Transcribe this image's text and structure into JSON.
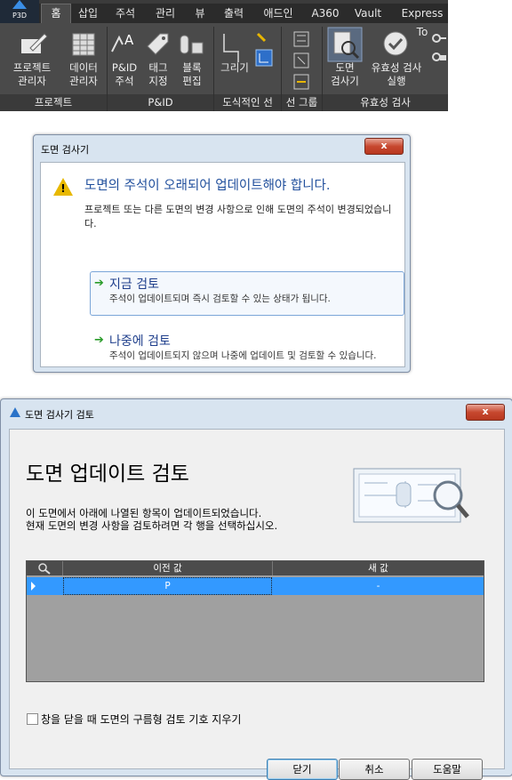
{
  "ribbon": {
    "app_button": "P3D",
    "tabs": [
      "홈",
      "삽입",
      "주석",
      "관리",
      "뷰",
      "출력",
      "애드인",
      "A360",
      "Vault",
      "Express To"
    ],
    "buttons": {
      "project_manager": [
        "프로젝트",
        "관리자"
      ],
      "data_manager": [
        "데이터",
        "관리자"
      ],
      "pid_annotation": [
        "P&ID",
        "주석"
      ],
      "tag_assign": [
        "태그",
        "지정"
      ],
      "block_edit": [
        "블록",
        "편집"
      ],
      "draw": "그리기",
      "drawing_checker": [
        "도면",
        "검사기"
      ],
      "validation_run": [
        "유효성 검사",
        "실행"
      ]
    },
    "panels": [
      "프로젝트",
      "P&ID",
      "도식적인 선",
      "선 그룹",
      "유효성 검사"
    ]
  },
  "dialog1": {
    "title": "도면 검사기",
    "close_label": "x",
    "heading": "도면의 주석이 오래되어 업데이트해야 합니다.",
    "description": "프로젝트 또는 다른 도면의 변경 사항으로 인해 도면의 주석이 변경되었습니다.",
    "option_now": {
      "title": "지금 검토",
      "description": "주석이 업데이트되며 즉시 검토할 수 있는 상태가 됩니다."
    },
    "option_later": {
      "title": "나중에 검토",
      "description": "주석이 업데이트되지 않으며 나중에 업데이트 및 검토할 수 있습니다."
    }
  },
  "dialog2": {
    "title": "도면 검사기 검토",
    "close_label": "x",
    "heading": "도면 업데이트 검토",
    "description_line1": "이 도면에서 아래에 나열된 항목이 업데이트되었습니다.",
    "description_line2": "현재 도면의 변경 사항을 검토하려면 각 행을 선택하십시오.",
    "grid": {
      "columns": [
        "이전 값",
        "새 값"
      ],
      "rows": [
        {
          "previous": "P",
          "new": "-"
        }
      ]
    },
    "checkbox_label": "창을 닫을 때 도면의 구름형 검토 기호 지우기",
    "checkbox_checked": false,
    "buttons": {
      "close": "닫기",
      "cancel": "취소",
      "help": "도움말"
    }
  }
}
